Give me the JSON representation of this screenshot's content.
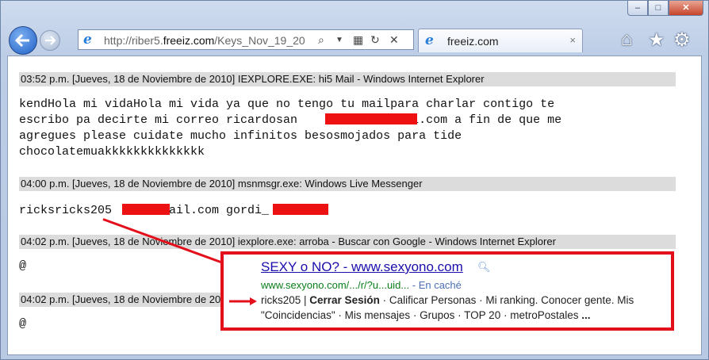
{
  "browser": {
    "address_url_prefix": "http://riber5.",
    "address_url_domain": "freeiz.com",
    "address_url_rest": "/Keys_Nov_19_20",
    "tab_title": "freeiz.com",
    "tab_close": "×",
    "caption_min": "–",
    "caption_max": "□",
    "caption_close": "✕"
  },
  "log": {
    "entries": [
      {
        "header": "03:52 p.m. [Jueves, 18 de Noviembre de 2010] IEXPLORE.EXE: hi5 Mail - Windows Internet Explorer",
        "lines": [
          "kendHola mi vidaHola mi vida ya que no tengo tu mailpara charlar contigo te",
          "escribo pa decirte mi correo ricardosan             mail.com a fin de que me",
          "agregues please cuidate mucho infinitos besosmojados para tide",
          "chocolatemuakkkkkkkkkkkkkk"
        ]
      },
      {
        "header": "04:00 p.m. [Jueves, 18 de Noviembre de 2010] msnmsgr.exe: Windows Live Messenger",
        "lines": [
          "ricksricks205        ail.com gordi_"
        ]
      },
      {
        "header": "04:02 p.m. [Jueves, 18 de Noviembre de 2010] iexplore.exe: arroba - Buscar con Google - Windows Internet Explorer",
        "lines": [
          "@"
        ]
      },
      {
        "header": "04:02 p.m. [Jueves, 18 de Noviembre de 2010",
        "lines": [
          "@"
        ]
      }
    ]
  },
  "callout": {
    "title": "SEXY o NO? - www.sexyono.com",
    "url": "www.sexyono.com/.../r/?u...uid...",
    "cache": " - En caché",
    "line1_user": "ricks205 | ",
    "line1_bold": "Cerrar Sesión",
    "line1_rest": " · Calificar Personas · Mi ranking. Conocer gente. Mis",
    "line2": "\"Coincidencias\" · Mis mensajes · Grupos · TOP 20 · metroPostales ",
    "line2_bold": "..."
  },
  "icons": {
    "back": "back-arrow-icon",
    "forward": "forward-arrow-icon",
    "home": "home-icon",
    "favorites": "star-icon",
    "tools": "gear-icon"
  },
  "colors": {
    "redaction": "#ee1111",
    "callout_border": "#e3101c",
    "link": "#1a0dab",
    "green_url": "#0a7f1a"
  }
}
